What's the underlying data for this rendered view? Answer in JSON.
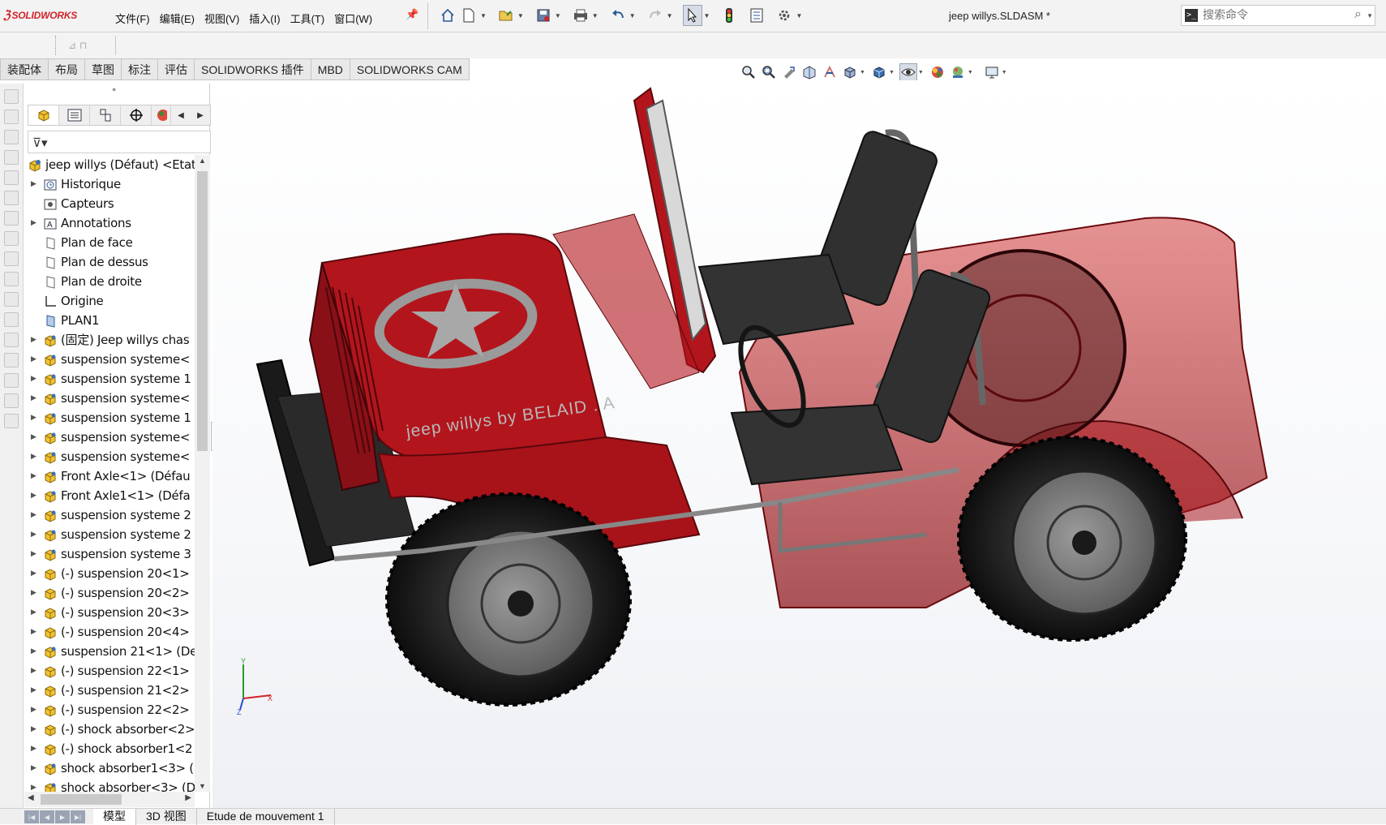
{
  "app": {
    "brand": "SOLIDWORKS",
    "document_title": "jeep willys.SLDASM *"
  },
  "menu": [
    {
      "label": "文件(F)",
      "name": "menu-file"
    },
    {
      "label": "编辑(E)",
      "name": "menu-edit"
    },
    {
      "label": "视图(V)",
      "name": "menu-view"
    },
    {
      "label": "插入(I)",
      "name": "menu-insert"
    },
    {
      "label": "工具(T)",
      "name": "menu-tools"
    },
    {
      "label": "窗口(W)",
      "name": "menu-window"
    }
  ],
  "search": {
    "placeholder": "搜索命令"
  },
  "command_tabs": [
    {
      "label": "装配体",
      "name": "tab-assembly"
    },
    {
      "label": "布局",
      "name": "tab-layout"
    },
    {
      "label": "草图",
      "name": "tab-sketch"
    },
    {
      "label": "标注",
      "name": "tab-markup"
    },
    {
      "label": "评估",
      "name": "tab-evaluate"
    },
    {
      "label": "SOLIDWORKS 插件",
      "name": "tab-addins"
    },
    {
      "label": "MBD",
      "name": "tab-mbd"
    },
    {
      "label": "SOLIDWORKS CAM",
      "name": "tab-cam"
    }
  ],
  "tree": {
    "root": "jeep willys (Défaut) <Etat",
    "items": [
      {
        "label": "Historique",
        "icon": "history-icon",
        "expandable": true
      },
      {
        "label": "Capteurs",
        "icon": "sensor-icon",
        "expandable": false
      },
      {
        "label": "Annotations",
        "icon": "annotation-icon",
        "expandable": true
      },
      {
        "label": "Plan de face",
        "icon": "plane-icon",
        "expandable": false
      },
      {
        "label": "Plan de dessus",
        "icon": "plane-icon",
        "expandable": false
      },
      {
        "label": "Plan de droite",
        "icon": "plane-icon",
        "expandable": false
      },
      {
        "label": "Origine",
        "icon": "origin-icon",
        "expandable": false
      },
      {
        "label": "PLAN1",
        "icon": "plane-blue-icon",
        "expandable": false
      },
      {
        "label": "(固定) Jeep willys chas",
        "icon": "subassembly-icon",
        "expandable": true
      },
      {
        "label": "suspension systeme<",
        "icon": "subassembly-icon",
        "expandable": true
      },
      {
        "label": "suspension systeme 1",
        "icon": "subassembly-icon",
        "expandable": true
      },
      {
        "label": "suspension systeme<",
        "icon": "subassembly-icon",
        "expandable": true
      },
      {
        "label": "suspension systeme 1",
        "icon": "subassembly-icon",
        "expandable": true
      },
      {
        "label": "suspension systeme<",
        "icon": "subassembly-icon",
        "expandable": true
      },
      {
        "label": "suspension systeme<",
        "icon": "subassembly-icon",
        "expandable": true
      },
      {
        "label": "Front Axle<1> (Défau",
        "icon": "subassembly-icon",
        "expandable": true
      },
      {
        "label": "Front Axle1<1> (Défa",
        "icon": "subassembly-icon",
        "expandable": true
      },
      {
        "label": "suspension systeme 2",
        "icon": "subassembly-icon",
        "expandable": true
      },
      {
        "label": "suspension systeme 2",
        "icon": "subassembly-icon",
        "expandable": true
      },
      {
        "label": "suspension systeme 3",
        "icon": "subassembly-icon",
        "expandable": true
      },
      {
        "label": "(-) suspension 20<1>",
        "icon": "subassembly-floating-icon",
        "expandable": true
      },
      {
        "label": "(-) suspension 20<2>",
        "icon": "subassembly-floating-icon",
        "expandable": true
      },
      {
        "label": "(-) suspension 20<3>",
        "icon": "subassembly-floating-icon",
        "expandable": true
      },
      {
        "label": "(-) suspension 20<4>",
        "icon": "subassembly-floating-icon",
        "expandable": true
      },
      {
        "label": "suspension 21<1> (De",
        "icon": "subassembly-icon",
        "expandable": true
      },
      {
        "label": "(-) suspension 22<1>",
        "icon": "subassembly-floating-icon",
        "expandable": true
      },
      {
        "label": "(-) suspension 21<2>",
        "icon": "subassembly-floating-icon",
        "expandable": true
      },
      {
        "label": "(-) suspension 22<2>",
        "icon": "subassembly-floating-icon",
        "expandable": true
      },
      {
        "label": "(-) shock absorber<2>",
        "icon": "subassembly-floating-icon",
        "expandable": true
      },
      {
        "label": "(-) shock absorber1<2",
        "icon": "subassembly-floating-icon",
        "expandable": true
      },
      {
        "label": "shock absorber1<3> (",
        "icon": "subassembly-icon",
        "expandable": true
      },
      {
        "label": "shock absorber<3> (D",
        "icon": "subassembly-icon",
        "expandable": true
      }
    ]
  },
  "model": {
    "hood_text": "jeep willys by BELAID . A",
    "body_color": "#b3151c",
    "triad_labels": [
      "X",
      "Y",
      "Z"
    ]
  },
  "bottom_tabs": [
    {
      "label": "模型",
      "name": "tab-model",
      "active": true
    },
    {
      "label": "3D 视图",
      "name": "tab-3d-views",
      "active": false
    },
    {
      "label": "Etude de mouvement 1",
      "name": "tab-motion-study",
      "active": false
    }
  ],
  "colors": {
    "accent_red": "#d2232a",
    "toolbar_bg": "#f3f3f3",
    "tree_icon_yellow": "#f2c230"
  }
}
